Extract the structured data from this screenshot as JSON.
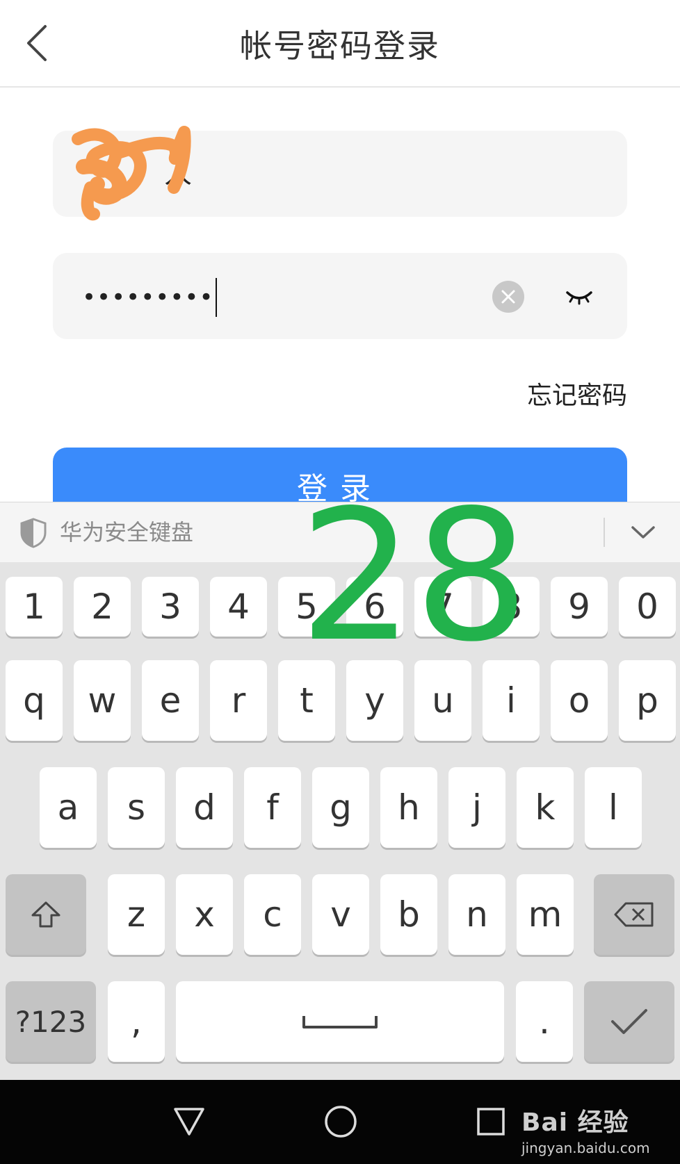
{
  "header": {
    "title": "帐号密码登录"
  },
  "form": {
    "account_value": "人",
    "password_dots": "•••••••••",
    "forgot_label": "忘记密码",
    "login_label": "登录"
  },
  "keyboard": {
    "brand": "华为安全键盘",
    "row_numbers": [
      "1",
      "2",
      "3",
      "4",
      "5",
      "6",
      "7",
      "8",
      "9",
      "0"
    ],
    "row_top": [
      "q",
      "w",
      "e",
      "r",
      "t",
      "y",
      "u",
      "i",
      "o",
      "p"
    ],
    "row_mid": [
      "a",
      "s",
      "d",
      "f",
      "g",
      "h",
      "j",
      "k",
      "l"
    ],
    "row_bottom": [
      "z",
      "x",
      "c",
      "v",
      "b",
      "n",
      "m"
    ],
    "symbols_label": "?123",
    "comma_label": ",",
    "period_label": "."
  },
  "overlay": {
    "step_number": "28"
  },
  "watermark": {
    "main": "Bai 经验",
    "sub": "jingyan.baidu.com"
  },
  "colors": {
    "accent": "#3a8bfb",
    "overlay": "#22b24c",
    "scribble": "#f59a4f"
  }
}
